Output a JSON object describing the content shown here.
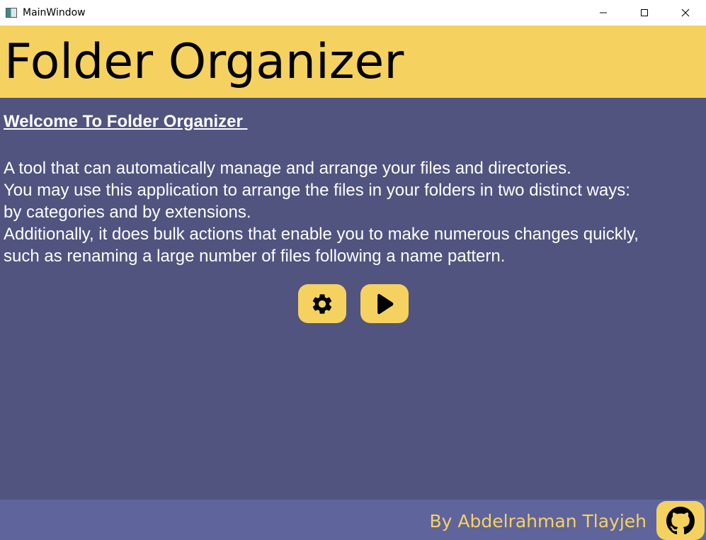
{
  "window": {
    "title": "MainWindow"
  },
  "header": {
    "title": "Folder Organizer"
  },
  "main": {
    "welcome_heading": "Welcome To Folder Organizer ",
    "description_lines": [
      "A tool that can automatically manage and arrange your files and directories.",
      "You may use this application to arrange the files in your folders in two distinct ways:",
      "by categories and by extensions.",
      "Additionally, it does bulk actions that enable you to make numerous changes quickly,",
      "such as renaming a large number of files following a name pattern."
    ],
    "buttons": [
      {
        "icon": "gear-icon"
      },
      {
        "icon": "play-icon"
      }
    ]
  },
  "footer": {
    "author": "By Abdelrahman Tlayjeh",
    "link_icon": "github-icon"
  },
  "colors": {
    "accent": "#f5d25f",
    "main_bg": "#50547f",
    "footer_bg": "#60649c"
  }
}
